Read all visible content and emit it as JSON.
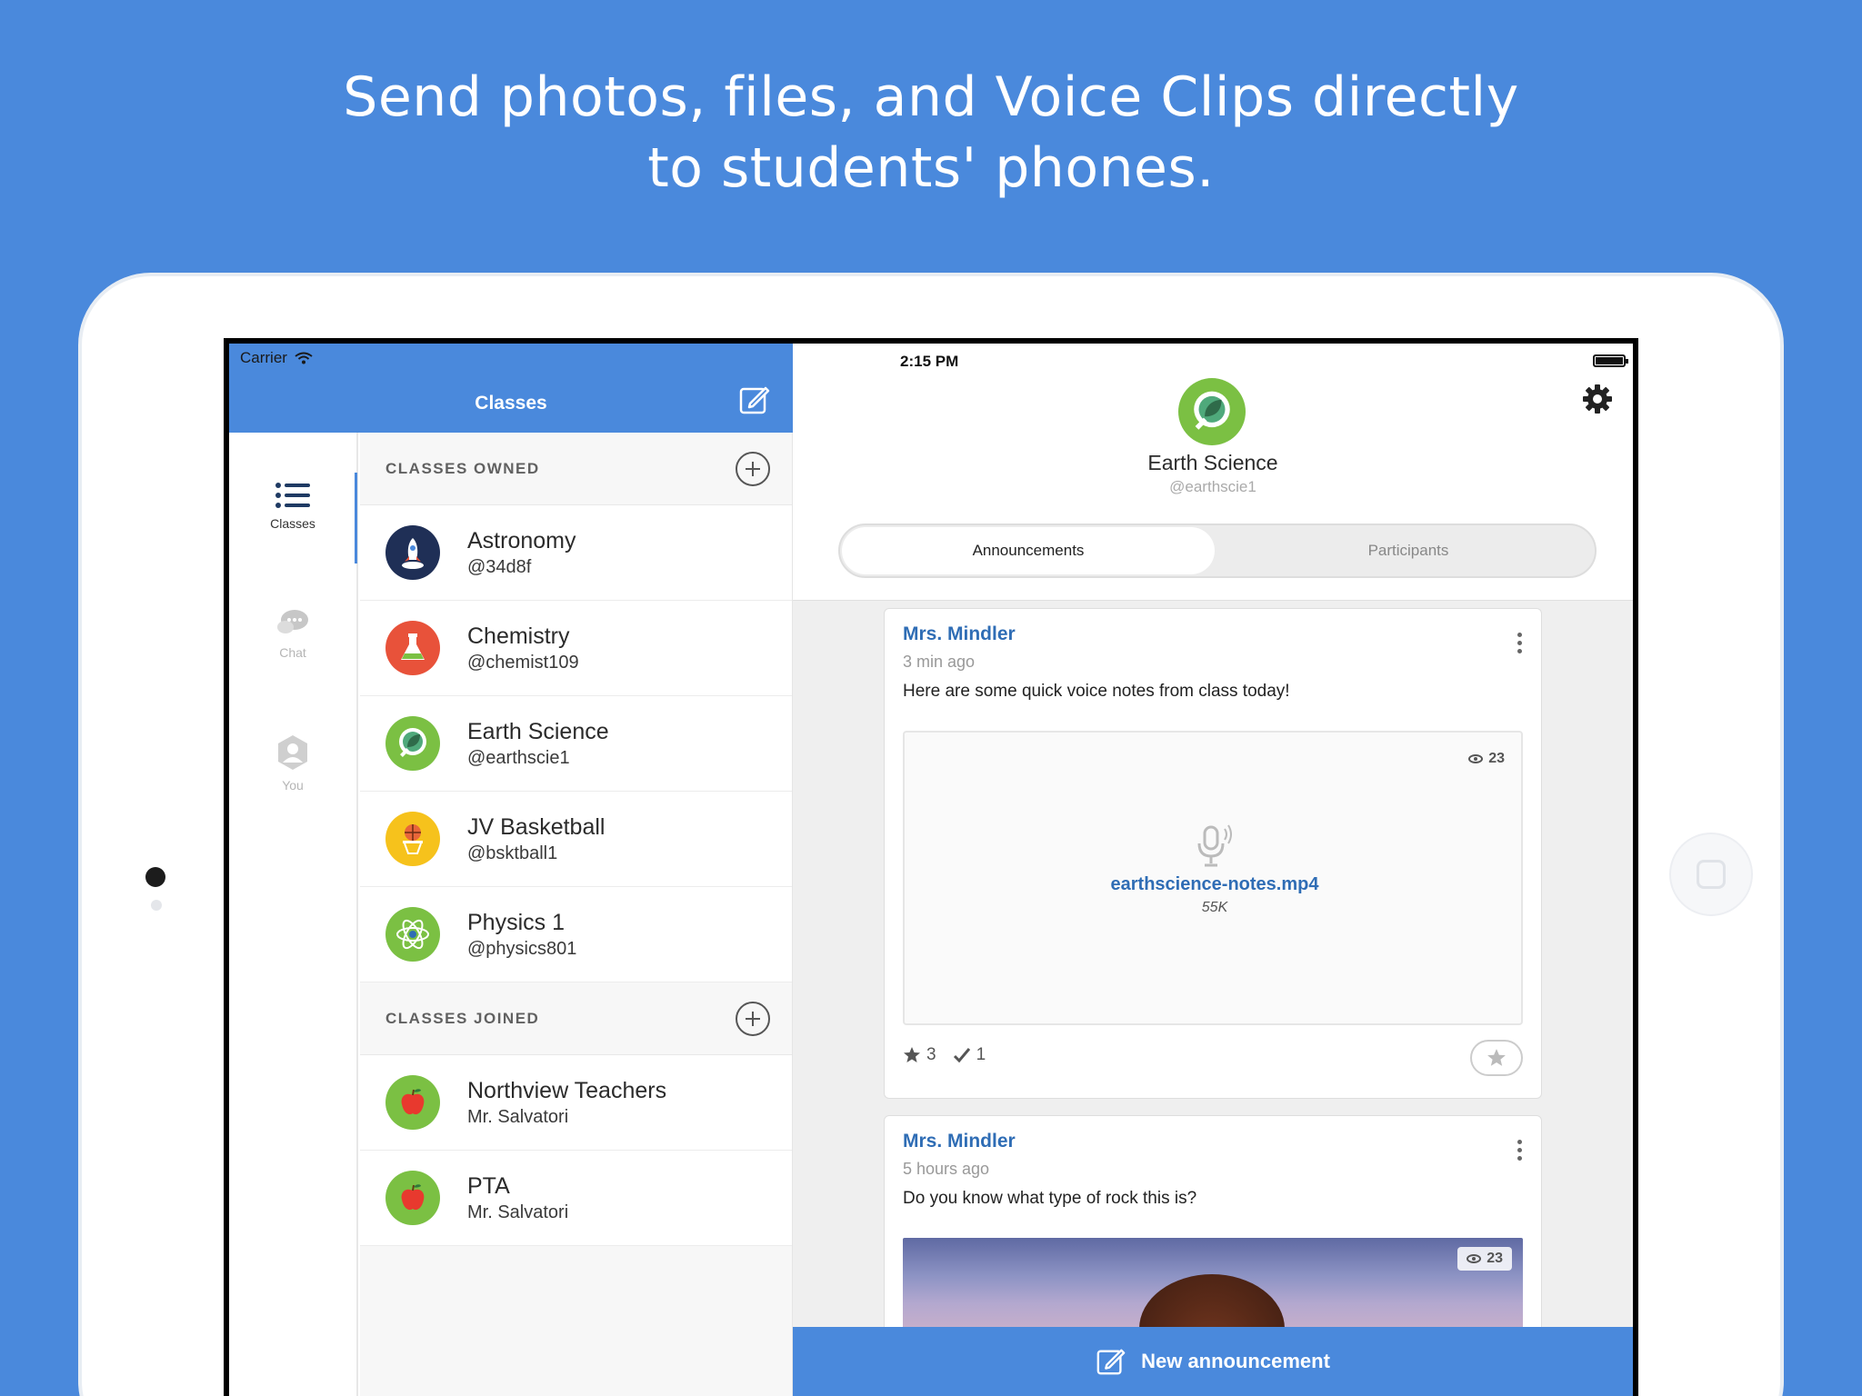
{
  "headline": {
    "line1": "Send photos, files, and Voice Clips directly",
    "line2": "to students' phones."
  },
  "status_bar": {
    "carrier": "Carrier",
    "time": "2:15 PM"
  },
  "left_header": {
    "title": "Classes"
  },
  "rail": {
    "items": [
      {
        "label": "Classes",
        "icon": "list-icon",
        "active": true
      },
      {
        "label": "Chat",
        "icon": "chat-bubble-icon",
        "active": false
      },
      {
        "label": "You",
        "icon": "user-hex-icon",
        "active": false
      }
    ]
  },
  "classes_owned": {
    "header": "CLASSES OWNED",
    "items": [
      {
        "name": "Astronomy",
        "handle": "@34d8f",
        "icon": "rocket-icon",
        "color": "#1f2f56"
      },
      {
        "name": "Chemistry",
        "handle": "@chemist109",
        "icon": "flask-icon",
        "color": "#e8523a"
      },
      {
        "name": "Earth Science",
        "handle": "@earthscie1",
        "icon": "leaf-magnifier-icon",
        "color": "#7bc043"
      },
      {
        "name": "JV Basketball",
        "handle": "@bsktball1",
        "icon": "basketball-hoop-icon",
        "color": "#f6c21c"
      },
      {
        "name": "Physics 1",
        "handle": "@physics801",
        "icon": "atom-icon",
        "color": "#7bc043"
      }
    ]
  },
  "classes_joined": {
    "header": "CLASSES JOINED",
    "items": [
      {
        "name": "Northview Teachers",
        "handle": "Mr. Salvatori",
        "icon": "apple-icon",
        "color": "#7bc043"
      },
      {
        "name": "PTA",
        "handle": "Mr. Salvatori",
        "icon": "apple-icon",
        "color": "#7bc043"
      }
    ]
  },
  "class_detail": {
    "title": "Earth Science",
    "handle": "@earthscie1",
    "tabs": [
      "Announcements",
      "Participants"
    ],
    "active_tab": "Announcements"
  },
  "posts": [
    {
      "author": "Mrs. Mindler",
      "ago": "3 min ago",
      "message": "Here are some quick voice notes from class today!",
      "attachment": {
        "type": "voice-clip",
        "filename": "earthscience-notes.mp4",
        "size": "55K",
        "views": "23"
      },
      "stars": "3",
      "checks": "1"
    },
    {
      "author": "Mrs. Mindler",
      "ago": "5 hours ago",
      "message": "Do you know what type of rock this is?",
      "attachment": {
        "type": "photo",
        "views": "23"
      }
    }
  ],
  "footer": {
    "new_announcement": "New announcement"
  },
  "colors": {
    "brand_blue": "#4a89dc",
    "link_blue": "#2f6db5"
  }
}
